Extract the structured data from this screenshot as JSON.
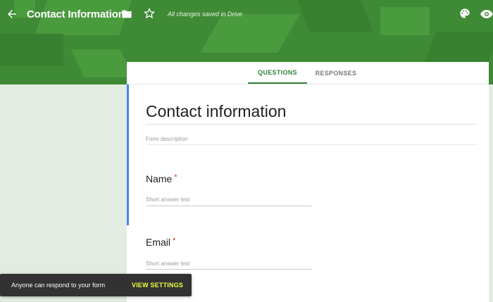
{
  "header": {
    "title": "Contact Information",
    "save_status": "All changes saved in Drive",
    "icons": [
      "back-arrow-icon",
      "folder-icon",
      "star-icon",
      "palette-icon",
      "eye-icon"
    ],
    "accent_color": "#3f8a35"
  },
  "tabs": [
    {
      "label": "QUESTIONS",
      "active": true
    },
    {
      "label": "RESPONSES",
      "active": false
    }
  ],
  "form": {
    "title": "Contact information",
    "description_placeholder": "Form description",
    "questions": [
      {
        "label": "Name",
        "required_marker": "*",
        "placeholder": "Short answer text"
      },
      {
        "label": "Email",
        "required_marker": "*",
        "placeholder": "Short answer text"
      }
    ]
  },
  "snackbar": {
    "message": "Anyone can respond to your form",
    "action": "VIEW SETTINGS"
  }
}
